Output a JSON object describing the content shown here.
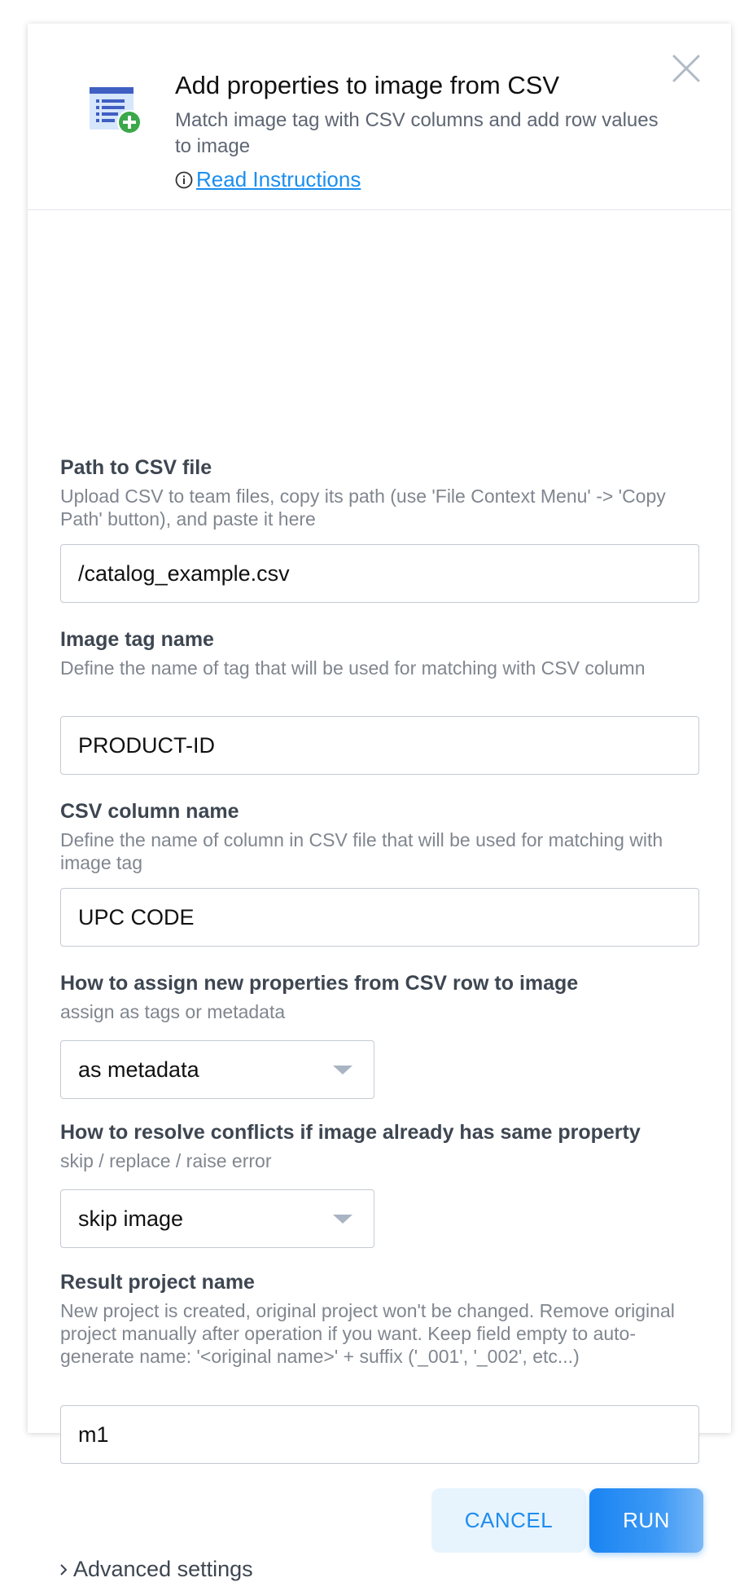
{
  "header": {
    "title": "Add properties to image from CSV",
    "subtitle": "Match image tag with CSV columns and add row values to image",
    "read_instructions": "Read Instructions"
  },
  "fields": {
    "csv_path": {
      "label": "Path to CSV file",
      "description": "Upload CSV to team files, copy its path (use 'File Context Menu' -> 'Copy Path' button), and paste it here",
      "value": "/catalog_example.csv"
    },
    "image_tag": {
      "label": "Image tag name",
      "description": "Define the name of tag that will be used for matching with CSV column",
      "value": "PRODUCT-ID"
    },
    "csv_column": {
      "label": "CSV column name",
      "description": "Define the name of column in CSV file that will be used for matching with image tag",
      "value": "UPC CODE"
    },
    "assign_mode": {
      "label": "How to assign new properties from CSV row to image",
      "description": "assign as tags or metadata",
      "selected": "as metadata"
    },
    "conflict_mode": {
      "label": "How to resolve conflicts if image already has same property",
      "description": "skip / replace / raise error",
      "selected": "skip image"
    },
    "result_project": {
      "label": "Result project name",
      "description": "New project is created, original project won't be changed. Remove original project manually after operation if you want. Keep field empty to auto-generate name: '<original name>' + suffix ('_001', '_002', etc...)",
      "value": "m1"
    }
  },
  "buttons": {
    "cancel": "CANCEL",
    "run": "RUN"
  },
  "advanced_settings": "Advanced settings",
  "colors": {
    "accent": "#1a8ef0",
    "run_button": "#1a84f2",
    "cancel_bg": "#e8f4fd",
    "label": "#3d4651",
    "description": "#80868f"
  },
  "icons": {
    "app": "table-add-icon",
    "close": "close-icon",
    "info": "info-icon",
    "select_caret": "chevron-down-icon",
    "advanced": "chevron-right-icon"
  }
}
